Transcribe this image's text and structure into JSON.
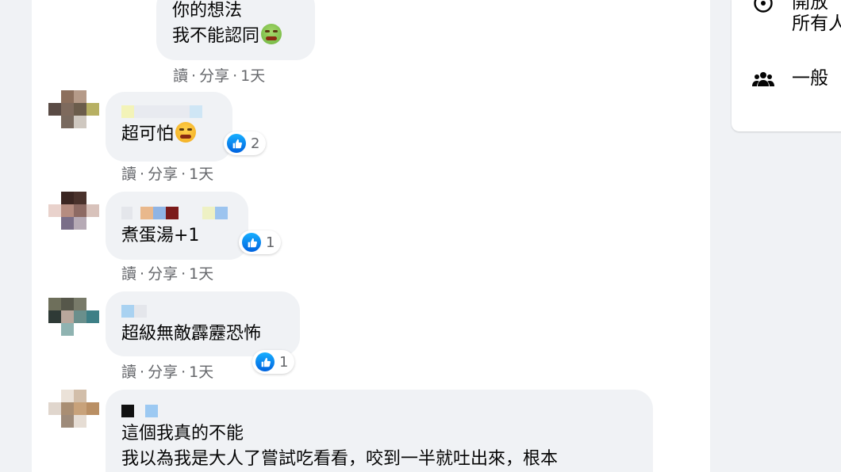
{
  "sidebar": {
    "rows": [
      {
        "icon": "globe-icon",
        "text": "開放\n所有人"
      },
      {
        "icon": "group-icon",
        "text": "一般"
      }
    ]
  },
  "comments": [
    {
      "lines": [
        "你的想法",
        "我不能認同"
      ],
      "emoji": "sick-face-emoji",
      "actions": {
        "reply": "讀",
        "share": "分享",
        "time": "1天"
      }
    },
    {
      "lines": [
        "超可怕"
      ],
      "emoji": "tired-face-emoji",
      "likes": "2",
      "actions": {
        "reply": "讀",
        "share": "分享",
        "time": "1天"
      }
    },
    {
      "lines": [
        "煮蛋湯+1"
      ],
      "likes": "1",
      "actions": {
        "reply": "讀",
        "share": "分享",
        "time": "1天"
      }
    },
    {
      "lines": [
        "超級無敵霹靂恐怖"
      ],
      "likes": "1",
      "actions": {
        "reply": "讀",
        "share": "分享",
        "time": "1天"
      }
    },
    {
      "lines": [
        "這個我真的不能",
        "我以為我是大人了嘗試吃看看，咬到一半就吐出來，根本"
      ]
    }
  ],
  "separator": "·",
  "colors": {
    "like_blue": "#1877f2",
    "bubble_bg": "#f0f2f5",
    "meta_text": "#65676b"
  }
}
